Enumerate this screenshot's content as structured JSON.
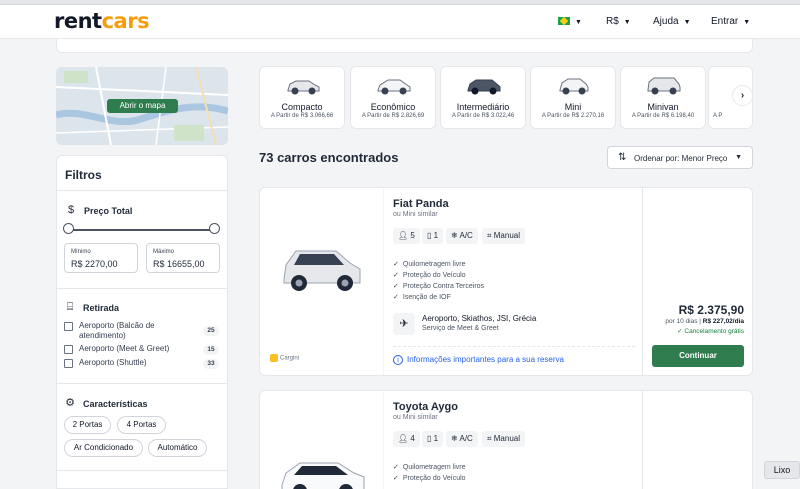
{
  "header": {
    "logo_main": "rent",
    "logo_accent": "cars",
    "currency": "R$",
    "help": "Ajuda",
    "login": "Entrar"
  },
  "map": {
    "button": "Abrir o mapa"
  },
  "categories": [
    {
      "name": "Compacto",
      "price": "A Partir de R$ 3.066,66"
    },
    {
      "name": "Econômico",
      "price": "A Partir de R$ 2.826,69"
    },
    {
      "name": "Intermediário",
      "price": "A Partir de R$ 3.022,46"
    },
    {
      "name": "Mini",
      "price": "A Partir de R$ 2.270,16"
    },
    {
      "name": "Minivan",
      "price": "A Partir de R$ 6.198,40"
    },
    {
      "name": "",
      "price": "A P"
    }
  ],
  "filters": {
    "title": "Filtros",
    "price": {
      "title": "Preço Total",
      "min_label": "Mínimo",
      "min_value": "R$ 2270,00",
      "max_label": "Máximo",
      "max_value": "R$ 16655,00"
    },
    "pickup": {
      "title": "Retirada",
      "options": [
        {
          "label": "Aeroporto (Balcão de atendimento)",
          "count": "25"
        },
        {
          "label": "Aeroporto (Meet & Greet)",
          "count": "15"
        },
        {
          "label": "Aeroporto (Shuttle)",
          "count": "33"
        }
      ]
    },
    "features": {
      "title": "Características",
      "chips": [
        "2 Portas",
        "4 Portas",
        "Ar Condicionado",
        "Automático"
      ]
    }
  },
  "results": {
    "count_text": "73 carros encontrados",
    "sort_label": "Ordenar por: Menor Preço"
  },
  "cars": [
    {
      "name": "Fiat Panda",
      "similar": "ou Mini similar",
      "seats": "5",
      "bags": "1",
      "ac": "A/C",
      "transmission": "Manual",
      "features": [
        "Quilometragem livre",
        "Proteção do Veículo",
        "Proteção Contra Terceiros",
        "Isenção de IOF"
      ],
      "pickup_location": "Aeroporto, Skiathos, JSI, Grécia",
      "pickup_service": "Serviço de Meet & Greet",
      "info_link": "Informações importantes para a sua reserva",
      "total": "R$ 2.375,90",
      "per_days": "por 10 dias |",
      "per_day": "R$ 227,02/dia",
      "cancel": "Cancelamento grátis",
      "continue": "Continuar",
      "supplier": "Cargini",
      "color": "#e5e7eb"
    },
    {
      "name": "Toyota Aygo",
      "similar": "ou Mini similar",
      "seats": "4",
      "bags": "1",
      "ac": "A/C",
      "transmission": "Manual",
      "features": [
        "Quilometragem livre",
        "Proteção do Veículo"
      ],
      "color": "#f3f4f6"
    }
  ],
  "trash": "Lixo"
}
